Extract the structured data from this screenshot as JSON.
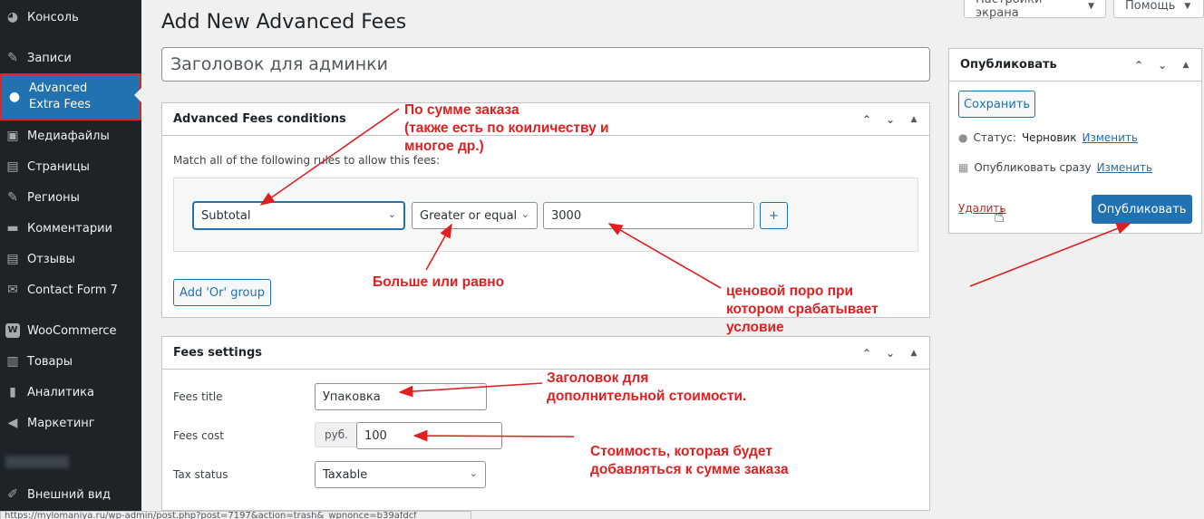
{
  "sidebar": {
    "items": [
      {
        "label": "Консоль",
        "icon": "dashboard-icon",
        "glyph": "◕"
      },
      {
        "label": "Записи",
        "icon": "pin-icon",
        "glyph": "✎"
      },
      {
        "label": "Advanced Extra Fees",
        "icon": "plugin-icon",
        "glyph": "●"
      },
      {
        "label": "Медиафайлы",
        "icon": "media-icon",
        "glyph": "▣"
      },
      {
        "label": "Страницы",
        "icon": "pages-icon",
        "glyph": "▤"
      },
      {
        "label": "Регионы",
        "icon": "pin-icon",
        "glyph": "✎"
      },
      {
        "label": "Комментарии",
        "icon": "comment-icon",
        "glyph": "▬"
      },
      {
        "label": "Отзывы",
        "icon": "reviews-icon",
        "glyph": "▤"
      },
      {
        "label": "Contact Form 7",
        "icon": "mail-icon",
        "glyph": "✉"
      },
      {
        "label": "WooCommerce",
        "icon": "woo-icon",
        "glyph": "W"
      },
      {
        "label": "Товары",
        "icon": "products-icon",
        "glyph": "▥"
      },
      {
        "label": "Аналитика",
        "icon": "analytics-icon",
        "glyph": "▮"
      },
      {
        "label": "Маркетинг",
        "icon": "megaphone-icon",
        "glyph": "◀"
      },
      {
        "label": "Внешний вид",
        "icon": "appearance-icon",
        "glyph": "✐"
      }
    ]
  },
  "screen_options": {
    "label": "Настройки экрана"
  },
  "help": {
    "label": "Помощь"
  },
  "page_title": "Add New Advanced Fees",
  "title_input": {
    "placeholder": "Заголовок для админки"
  },
  "conditions": {
    "title": "Advanced Fees conditions",
    "match_text": "Match all of the following rules to allow this fees:",
    "condition_select": "Subtotal",
    "operator_select": "Greater or equal t",
    "value": "3000",
    "add_button": "+",
    "add_or_group": "Add 'Or' group"
  },
  "fees_settings": {
    "title": "Fees settings",
    "fees_title_label": "Fees title",
    "fees_title_value": "Упаковка",
    "fees_cost_label": "Fees cost",
    "currency": "руб.",
    "fees_cost_value": "100",
    "tax_status_label": "Tax status",
    "tax_status_value": "Taxable"
  },
  "publish": {
    "title": "Опубликовать",
    "save_draft": "Сохранить",
    "status_label": "Статус:",
    "status_value": "Черновик",
    "edit_link": "Изменить",
    "publish_immediately": "Опубликовать сразу",
    "edit_link2": "Изменить",
    "delete": "Удалить",
    "publish_button": "Опубликовать"
  },
  "annotations": {
    "subtotal_note": [
      "По сумме заказа",
      "(также есть по коиличеству и",
      "многое др.)"
    ],
    "operator_note": "Больше или равно",
    "threshold_note": [
      "ценовой поро при",
      "котором срабатывает",
      "условие"
    ],
    "title_note": [
      "Заголовок для",
      "дополнительной стоимости."
    ],
    "cost_note": [
      "Стоимость, которая будет",
      "добавляться к сумме заказа"
    ]
  },
  "status_url": "https://mylomaniya.ru/wp-admin/post.php?post=7197&action=trash&_wpnonce=b39afdcf",
  "colors": {
    "sidebar": "#1d2327",
    "accent": "#2271b1",
    "annotation": "#e02020"
  }
}
